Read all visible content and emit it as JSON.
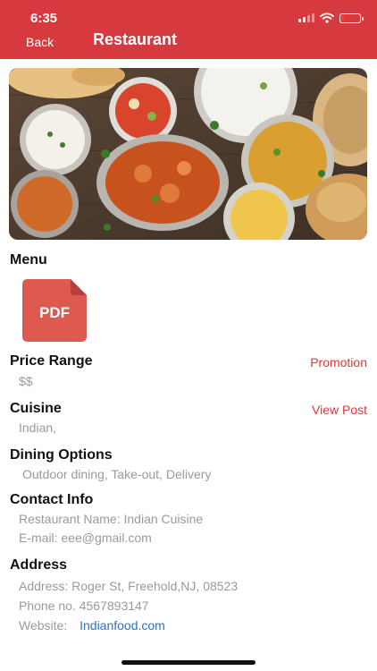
{
  "status": {
    "time": "6:35"
  },
  "nav": {
    "back_label": "Back",
    "title": "Restaurant"
  },
  "menu": {
    "title": "Menu",
    "pdf_label": "PDF"
  },
  "price": {
    "title": "Price Range",
    "value": "$$",
    "promotion_link": "Promotion"
  },
  "cuisine": {
    "title": "Cuisine",
    "value": "Indian,",
    "view_post_link": "View Post"
  },
  "dining": {
    "title": "Dining Options",
    "value": "Outdoor dining, Take-out, Delivery"
  },
  "contact": {
    "title": "Contact Info",
    "restaurant_name": "Restaurant Name: Indian Cuisine",
    "email": "E-mail: eee@gmail.com"
  },
  "address": {
    "title": "Address",
    "address_line": "Address: Roger St, Freehold,NJ, 08523",
    "phone": "Phone no. 4567893147",
    "website_label": "Website:",
    "website_link": "Indianfood.com"
  },
  "colors": {
    "brand": "#d63a3e",
    "pdf": "#de5a50",
    "link": "#2f6fc6"
  }
}
